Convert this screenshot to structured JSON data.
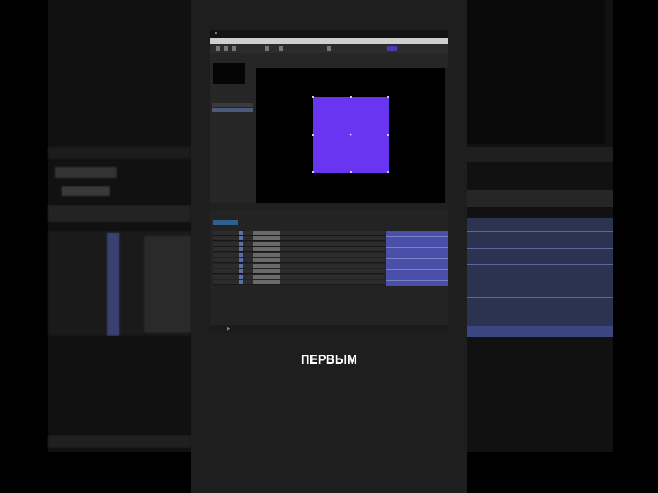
{
  "caption": "ПЕРВЫМ",
  "colors": {
    "shape_fill": "#6a35f0",
    "track_fill": "#4a4fa8",
    "background": "#000000",
    "panel": "#262626"
  },
  "icons": [
    "apple-logo-icon",
    "selection-tool-icon",
    "pen-tool-icon",
    "play-icon"
  ]
}
